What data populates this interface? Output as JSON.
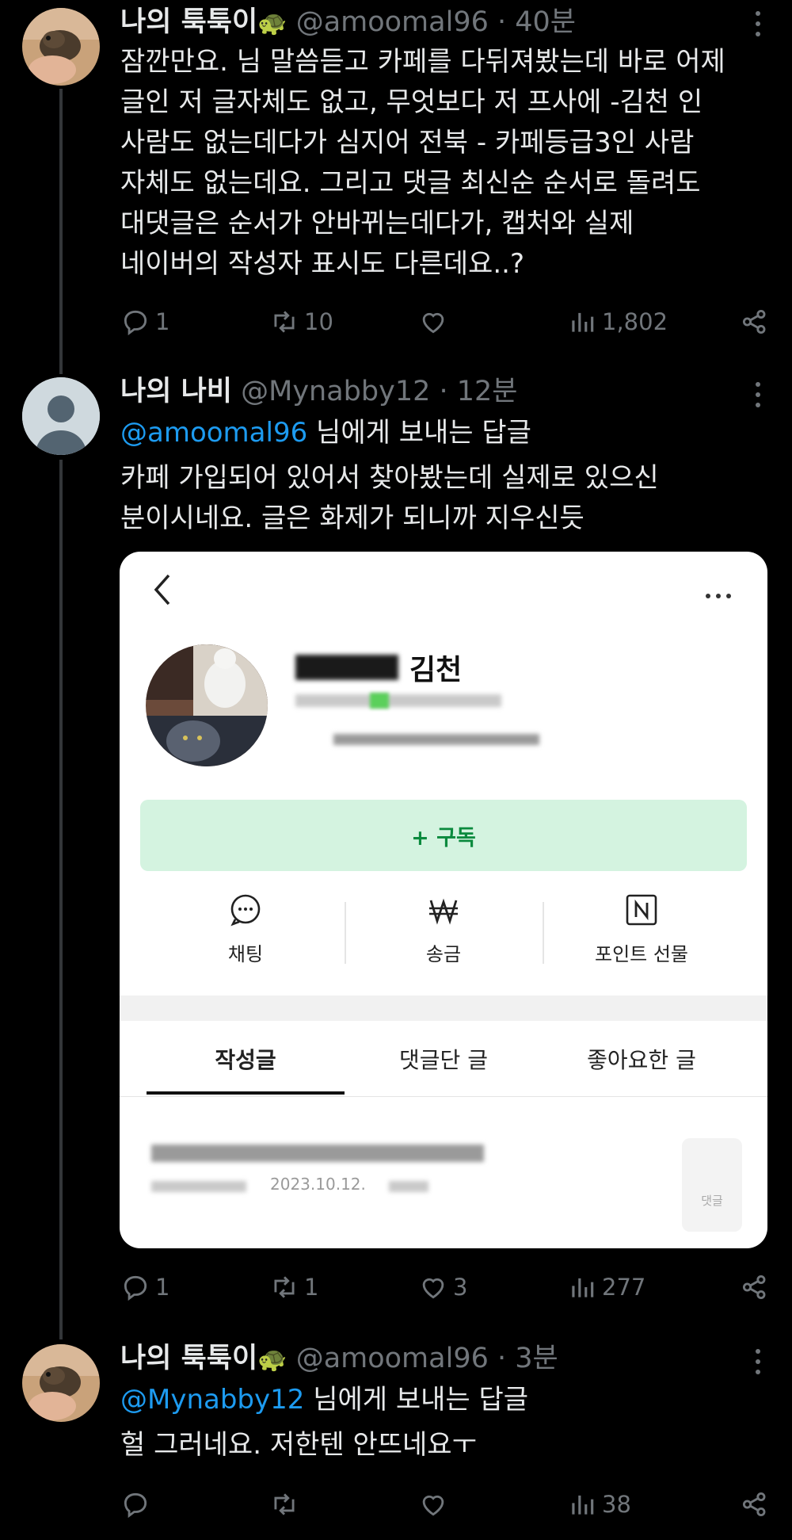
{
  "tweets": [
    {
      "name": "나의 툭툭이",
      "emoji": "🐢",
      "handle": "@amoomal96",
      "time": "40분",
      "lines": [
        "잠깐만요. 님 말씀듣고 카페를 다뒤져봤는데 바로 어제",
        "글인 저 글자체도 없고, 무엇보다 저 프사에 -김천 인",
        "사람도 없는데다가 심지어 전북 - 카페등급3인 사람",
        "자체도 없는데요. 그리고 댓글 최신순 순서로 돌려도",
        "대댓글은 순서가 안바뀌는데다가, 캡처와 실제",
        "네이버의 작성자 표시도 다른데요..?"
      ],
      "replies": "1",
      "retweets": "10",
      "likes": "",
      "views": "1,802"
    },
    {
      "name": "나의 나비",
      "handle": "@Mynabby12",
      "time": "12분",
      "reply_to": "@amoomal96",
      "reply_suffix": " 님에게 보내는 답글",
      "lines": [
        "카페 가입되어 있어서 찾아봤는데 실제로 있으신",
        "분이시네요. 글은 화제가 되니까 지우신듯"
      ],
      "replies": "1",
      "retweets": "1",
      "likes": "3",
      "views": "277"
    },
    {
      "name": "나의 툭툭이",
      "emoji": "🐢",
      "handle": "@amoomal96",
      "time": "3분",
      "reply_to": "@Mynabby12",
      "reply_suffix": " 님에게 보내는 답글",
      "lines": [
        "헐 그러네요. 저한텐 안뜨네요ㅜ"
      ],
      "replies": "",
      "retweets": "",
      "likes": "",
      "views": "38"
    }
  ],
  "card": {
    "profile_name_suffix": "김천",
    "subscribe": "+ 구독",
    "quick_actions": [
      "채팅",
      "송금",
      "포인트 선물"
    ],
    "tabs": [
      "작성글",
      "댓글단 글",
      "좋아요한 글"
    ],
    "post_date": "2023.10.12.",
    "thumb_label": "댓글"
  },
  "colors": {
    "background": "#000000",
    "text": "#e7e9ea",
    "muted": "#71767b",
    "mention": "#1d9bf0",
    "subscribe_bg": "#d4f3e0",
    "subscribe_text": "#0b8a3e"
  },
  "icons": [
    "reply-icon",
    "retweet-icon",
    "like-icon",
    "views-icon",
    "share-icon",
    "more-icon",
    "back-icon",
    "chat-icon",
    "won-icon",
    "naver-point-icon"
  ]
}
